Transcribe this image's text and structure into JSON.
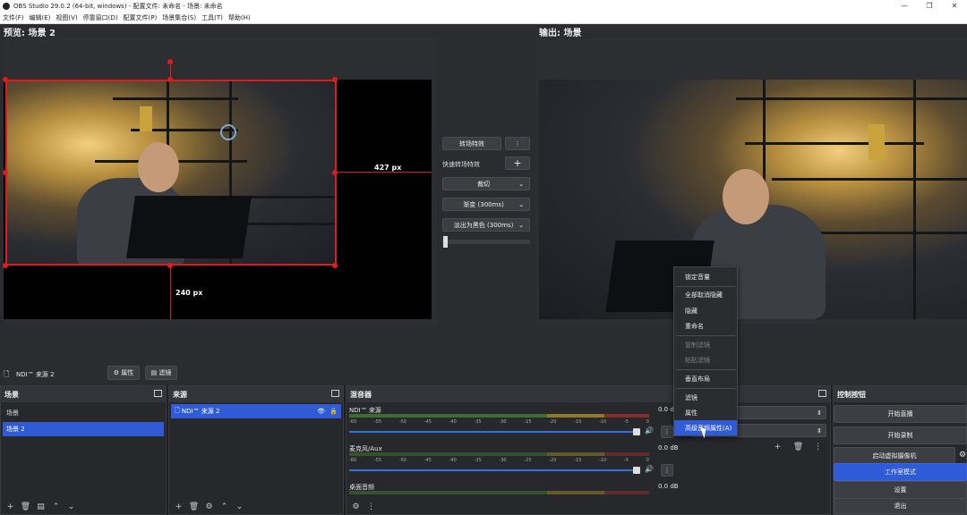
{
  "window": {
    "title": "OBS Studio 29.0.2 (64-bit, windows) - 配置文件: 未命名 - 场景: 未命名",
    "controls": [
      "—",
      "❐",
      "✕"
    ]
  },
  "menu": [
    "文件(F)",
    "编辑(E)",
    "视图(V)",
    "停靠窗口(D)",
    "配置文件(P)",
    "场景集合(S)",
    "工具(T)",
    "帮助(H)"
  ],
  "preview": {
    "title": "预览: 场景 2",
    "dim_right": "427 px",
    "dim_bottom": "240 px"
  },
  "output": {
    "title": "输出: 场景"
  },
  "transition": {
    "effect_button": "转场特效",
    "quick_label": "快速转场特效",
    "options": [
      "裁切",
      "渐变 (300ms)",
      "淡出为黑色 (300ms)"
    ]
  },
  "context_menu": {
    "items": [
      {
        "label": "锁定音量",
        "disabled": false
      },
      {
        "label": "全部取消隐藏",
        "disabled": false
      },
      {
        "label": "隐藏",
        "disabled": false
      },
      {
        "label": "重命名",
        "disabled": false
      },
      {
        "label": "复制滤镜",
        "disabled": true
      },
      {
        "label": "粘贴滤镜",
        "disabled": true
      },
      {
        "label": "垂直布局",
        "disabled": false
      },
      {
        "label": "滤镜",
        "disabled": false
      },
      {
        "label": "属性",
        "disabled": false
      },
      {
        "label": "高级音频属性(A)",
        "disabled": false
      }
    ]
  },
  "source_toolbar": {
    "name": "NDI™ 来源 2",
    "properties": "属性",
    "filters": "滤镜"
  },
  "scenes": {
    "title": "场景",
    "items": [
      {
        "label": "场景",
        "selected": false
      },
      {
        "label": "场景 2",
        "selected": true
      }
    ]
  },
  "sources": {
    "title": "来源",
    "items": [
      {
        "label": "NDI™ 来源 2",
        "selected": true
      }
    ]
  },
  "mixer": {
    "title": "混音器",
    "ticks": [
      "-60",
      "-55",
      "-50",
      "-45",
      "-40",
      "-35",
      "-30",
      "-25",
      "-20",
      "-15",
      "-10",
      "-5",
      "0"
    ],
    "channels": [
      {
        "name": "NDI™ 来源",
        "db": "0.0 dB",
        "level": 0.85
      },
      {
        "name": "麦克风/Aux",
        "db": "0.0 dB",
        "level": 0.0
      },
      {
        "name": "桌面音频",
        "db": "0.0 dB",
        "level": 0.0
      }
    ]
  },
  "controls": {
    "title": "控制按钮",
    "buttons": [
      "开始直播",
      "开始录制",
      "启动虚拟摄像机",
      "工作室模式",
      "设置",
      "退出"
    ]
  },
  "colors": {
    "accent": "#2f5bd6",
    "selection_red": "#e01b1b",
    "panel": "#27282c"
  }
}
